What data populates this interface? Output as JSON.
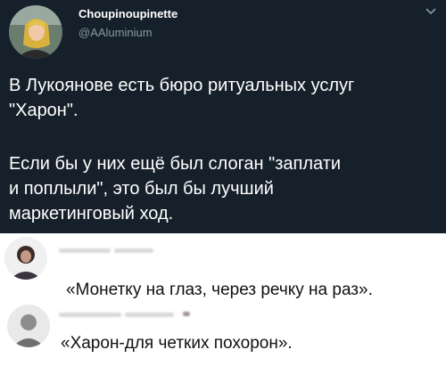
{
  "tweet": {
    "author_name": "Choupinoupinette",
    "author_handle": "@AAluminium",
    "paragraph_1": "В Лукоянове есть бюро ритуальных услуг\n\"Харон\".",
    "paragraph_2": "Если бы у них ещё был слоган \"заплати\nи поплыли\", это был бы лучший\nмаркетинговый ход."
  },
  "comments": [
    {
      "text": "«Монетку на глаз, через речку на раз»."
    },
    {
      "text": "«Харон-для четких похорон»."
    }
  ],
  "icons": {
    "tweet_menu": "chevron-down-icon",
    "tweet_avatar": "avatar",
    "comment_avatar": "avatar"
  },
  "colors": {
    "tweet_background": "#15202b",
    "tweet_text": "#ffffff",
    "handle_text": "#8899a6",
    "comment_background": "#ffffff",
    "comment_text": "#111111"
  }
}
